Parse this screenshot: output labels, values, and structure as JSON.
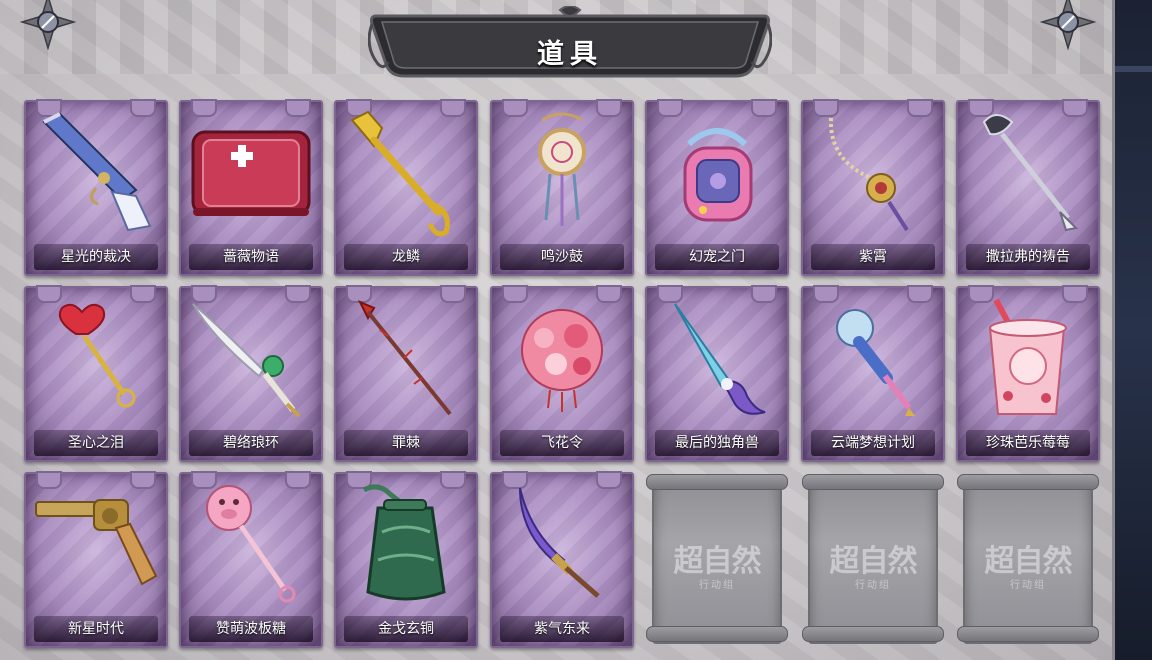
{
  "header": {
    "title": "道具"
  },
  "items_row1": [
    {
      "label": "星光的裁决",
      "icon": "flintlock-pistol-icon"
    },
    {
      "label": "蔷薇物语",
      "icon": "medkit-box-icon"
    },
    {
      "label": "龙鳞",
      "icon": "golden-shovel-icon"
    },
    {
      "label": "鸣沙鼓",
      "icon": "dreamcatcher-drum-icon"
    },
    {
      "label": "幻宠之门",
      "icon": "pet-device-icon"
    },
    {
      "label": "紫霄",
      "icon": "pendant-chain-icon"
    },
    {
      "label": "撒拉弗的祷告",
      "icon": "silver-scepter-icon"
    }
  ],
  "items_row2": [
    {
      "label": "圣心之泪",
      "icon": "heart-scepter-icon"
    },
    {
      "label": "碧络琅环",
      "icon": "jade-blade-icon"
    },
    {
      "label": "罪棘",
      "icon": "thorn-staff-icon"
    },
    {
      "label": "飞花令",
      "icon": "flower-bouquet-icon"
    },
    {
      "label": "最后的独角兽",
      "icon": "unicorn-horn-sword-icon"
    },
    {
      "label": "云端梦想计划",
      "icon": "cloud-mace-icon"
    },
    {
      "label": "珍珠芭乐莓莓",
      "icon": "bubble-tea-cup-icon"
    }
  ],
  "items_row3": [
    {
      "label": "新星时代",
      "icon": "revolver-icon"
    },
    {
      "label": "赞萌波板糖",
      "icon": "pig-lollipop-icon"
    },
    {
      "label": "金戈玄铜",
      "icon": "bronze-grenade-icon"
    },
    {
      "label": "紫气东来",
      "icon": "purple-sword-icon"
    }
  ],
  "empty_slots": [
    {
      "watermark": "超自然",
      "sub": "行动组"
    },
    {
      "watermark": "超自然",
      "sub": "行动组"
    },
    {
      "watermark": "超自然",
      "sub": "行动组"
    }
  ],
  "colors": {
    "card_purple": "#a78abf",
    "banner_dark": "#2c2c30",
    "empty_gray": "#9a9aa0"
  }
}
